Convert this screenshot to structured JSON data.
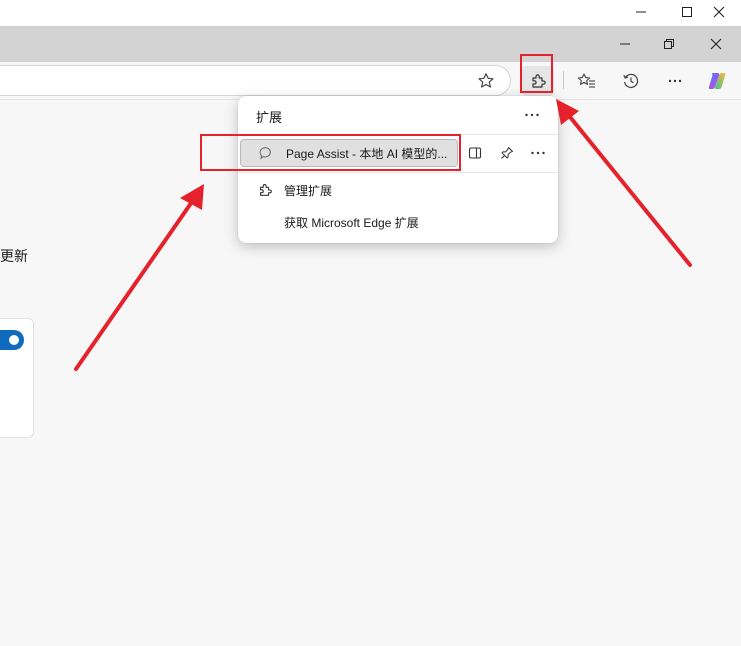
{
  "window_controls": {
    "minimize_glyph": "—",
    "maximize_glyph": "☐",
    "close_glyph": "✕"
  },
  "browser_controls": {
    "minimize_glyph": "—",
    "restore_glyph": "❐",
    "close_glyph": "✕"
  },
  "toolbar": {
    "favorite_icon": "star-icon",
    "extensions_icon": "puzzle-icon",
    "favorites_icon": "favorites-icon",
    "history_icon": "history-icon",
    "more_icon": "more-icon",
    "copilot_icon": "copilot-icon"
  },
  "page": {
    "cut_text": "更新"
  },
  "extensions_popup": {
    "title": "扩展",
    "more_glyph": "···",
    "extension": {
      "name": "Page Assist - 本地 AI 模型的...",
      "icon": "chat-bubble-icon",
      "more_glyph": "···"
    },
    "manage_label": "管理扩展",
    "get_label": "获取 Microsoft Edge 扩展"
  },
  "colors": {
    "annotation_red": "#e5222b",
    "accent_blue": "#0f6cbd"
  }
}
